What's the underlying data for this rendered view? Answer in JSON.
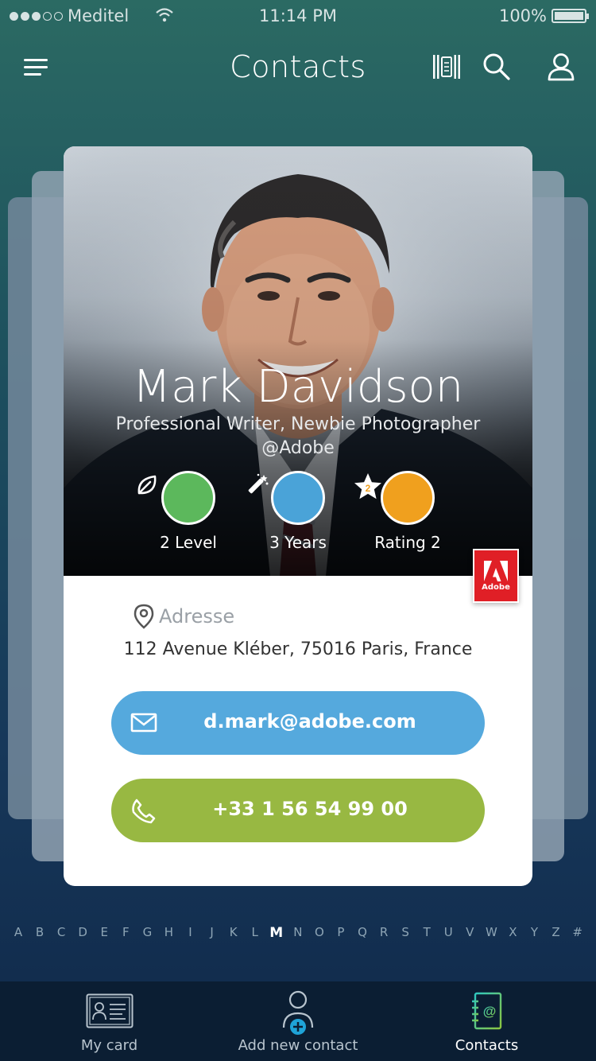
{
  "status": {
    "carrier": "Meditel",
    "time": "11:14 PM",
    "battery": "100%"
  },
  "header": {
    "title": "Contacts"
  },
  "contact": {
    "name": "Mark Davidson",
    "subtitle_line1": "Professional Writer, Newbie Photographer",
    "subtitle_line2": "@Adobe",
    "stats": [
      {
        "label": "2 Level",
        "color": "#5cb85c",
        "icon": "leaf-icon"
      },
      {
        "label": "3 Years",
        "color": "#4aa3d8",
        "icon": "magic-wand-icon"
      },
      {
        "label": "Rating 2",
        "color": "#f0a01e",
        "icon": "star-icon",
        "badge": "2"
      }
    ],
    "company_logo_text": "Adobe",
    "address_label": "Adresse",
    "address": "112 Avenue Kléber, 75016 Paris, France",
    "email": "d.mark@adobe.com",
    "phone": "+33 1 56 54 99 00"
  },
  "alphabet": [
    "A",
    "B",
    "C",
    "D",
    "E",
    "F",
    "G",
    "H",
    "I",
    "J",
    "K",
    "L",
    "M",
    "N",
    "O",
    "P",
    "Q",
    "R",
    "S",
    "T",
    "U",
    "V",
    "W",
    "X",
    "Y",
    "Z",
    "#"
  ],
  "alphabet_active": "M",
  "tabs": [
    {
      "label": "My card",
      "icon": "id-card-icon"
    },
    {
      "label": "Add  new contact",
      "icon": "add-contact-icon"
    },
    {
      "label": "Contacts",
      "icon": "address-book-icon"
    }
  ],
  "colors": {
    "email": "#55a9dd",
    "phone": "#98b842",
    "adobe": "#e01f26"
  }
}
